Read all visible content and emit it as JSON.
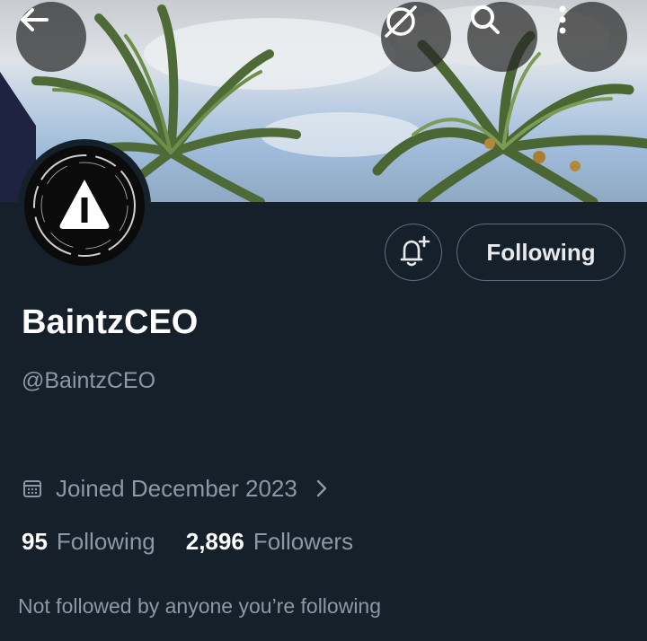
{
  "header": {
    "back_icon": "arrow-left-icon",
    "grok_icon": "slashed-circle-icon",
    "search_icon": "search-icon",
    "more_icon": "vertical-ellipsis-icon"
  },
  "profile": {
    "display_name": "BaintzCEO",
    "handle": "@BaintzCEO",
    "joined": "Joined December 2023",
    "following_count": "95",
    "following_label": "Following",
    "followers_count": "2,896",
    "followers_label": "Followers",
    "not_followed_text": "Not followed by anyone you’re following"
  },
  "actions": {
    "follow_button_label": "Following",
    "notify_icon": "bell-plus-icon"
  },
  "colors": {
    "background": "#15202b",
    "text_primary": "#e7e9ea",
    "text_secondary": "#8b98a5",
    "border": "#5b6f80"
  }
}
